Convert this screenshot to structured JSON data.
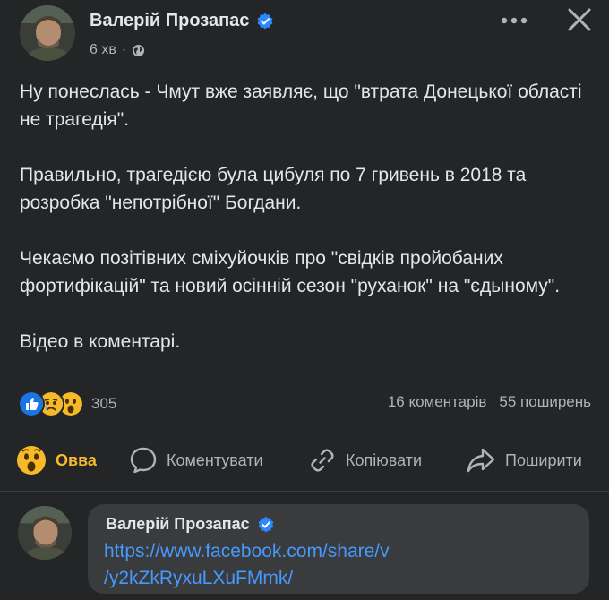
{
  "post": {
    "author": "Валерій Прозапас",
    "time": "6 хв",
    "separator": "·",
    "paragraphs": [
      "Ну понеслась - Чмут вже заявляє, що \"втрата Донецької області не трагедія\".",
      "Правильно, трагедією була цибуля по 7 гривень в 2018 та розробка \"непотрібної\" Богдани.",
      "Чекаємо позітівних сміхуйочків про \"свідків пройобаних фортифікацій\" та новий осінній сезон  \"руханок\" на \"єдыному\".",
      "Відео в коментарі."
    ]
  },
  "reactions": {
    "count": "305",
    "icons": [
      "like-reaction",
      "sad-reaction",
      "wow-reaction"
    ]
  },
  "stats": {
    "comments": "16 коментарів",
    "shares": "55 поширень"
  },
  "actions": {
    "reaction_label": "Овва",
    "comment_label": "Коментувати",
    "copy_label": "Копіювати",
    "share_label": "Поширити"
  },
  "comment": {
    "author": "Валерій Прозапас",
    "link_line1": "https://www.facebook.com/share/v",
    "link_line2": "/y2kZkRyxuLXuFMmk/"
  },
  "colors": {
    "background": "#242526",
    "bubble": "#3a3b3c",
    "text": "#e4e6eb",
    "secondary": "#b0b3b8",
    "link": "#4599ff",
    "verified": "#2d88ff",
    "wow": "#f7b928"
  }
}
